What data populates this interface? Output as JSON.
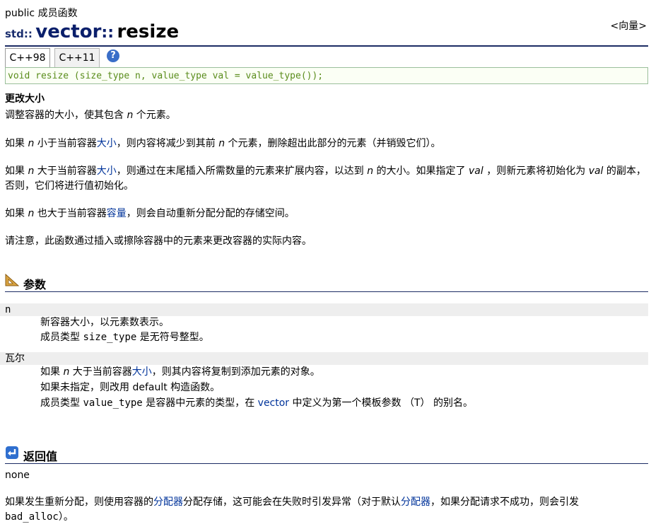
{
  "header": {
    "kicker": "public 成员函数",
    "ns": "std::",
    "class_name": "vector",
    "sep": "::",
    "member": "resize",
    "back_link": "<向量>"
  },
  "versions": {
    "tabs": [
      "C++98",
      "C++11"
    ],
    "help_icon": "help-icon"
  },
  "declaration": "void resize (size_type n, value_type val = value_type());",
  "description": {
    "heading": "更改大小",
    "p1": {
      "a": "调整容器的大小，使其包含 ",
      "n": "n",
      "b": " 个元素。"
    },
    "p2": {
      "a": "如果 ",
      "n1": "n",
      "b": " 小于当前容器",
      "link": "大小",
      "c": "，则内容将减少到其前 ",
      "n2": "n",
      "d": " 个元素，删除超出此部分的元素（并销毁它们）。"
    },
    "p3": {
      "a": "如果 ",
      "n1": "n",
      "b": " 大于当前容器",
      "link": "大小",
      "c": "，则通过在末尾插入所需数量的元素来扩展内容，以达到 ",
      "n2": "n",
      "d": " 的大小。如果指定了 ",
      "v1": "val",
      "e": " ，则新元素将初始化为 ",
      "v2": "val",
      "f": " 的副本，否则，它们将进行值初始化。"
    },
    "p4": {
      "a": "如果 ",
      "n": "n",
      "b": " 也大于当前容器",
      "link": "容量",
      "c": "，则会自动重新分配分配的存储空间。"
    },
    "p5": "请注意，此函数通过插入或擦除容器中的元素来更改容器的实际内容。"
  },
  "parameters": {
    "heading": "参数",
    "n": {
      "name": "n",
      "line1": "新容器大小，以元素数表示。",
      "l2a": "成员类型 ",
      "l2code": "size_type",
      "l2b": " 是无符号整型。"
    },
    "val": {
      "name": "瓦尔",
      "l1a": "如果 ",
      "l1n": "n",
      "l1b": " 大于当前容器",
      "l1link": "大小",
      "l1c": "，则其内容将复制到添加元素的对象。",
      "line2": "如果未指定，则改用 default 构造函数。",
      "l3a": "成员类型 ",
      "l3code": "value_type",
      "l3b": " 是容器中元素的类型，在 ",
      "l3link": "vector",
      "l3c": " 中定义为第一个模板参数 （T） 的别名。"
    }
  },
  "return_value": {
    "heading": "返回值",
    "value": "none",
    "pa": "如果发生重新分配，则使用容器的",
    "plink1": "分配器",
    "pb": "分配存储，这可能会在失败时引发异常（对于默认",
    "plink2": "分配器",
    "pc": "，如果分配请求不成功，则会引发",
    "code": "bad_alloc",
    "pd": "）。"
  },
  "colors": {
    "heading_blue": "#0a1f6b",
    "link": "#00339a",
    "rule": "#1c2c64",
    "decl_text": "#5a8c1c",
    "param_bg": "#eeeeee"
  }
}
